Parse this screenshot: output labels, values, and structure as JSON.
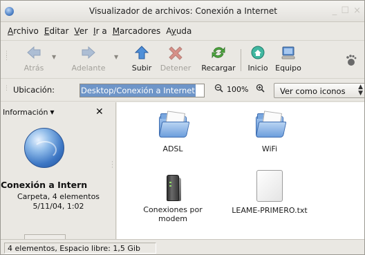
{
  "window": {
    "title": "Visualizador de archivos: Conexión a Internet",
    "controls": "_ ☐ ×"
  },
  "menubar": {
    "items": [
      {
        "ul": "A",
        "rest": "rchivo"
      },
      {
        "ul": "E",
        "rest": "ditar"
      },
      {
        "ul": "V",
        "rest": "er"
      },
      {
        "ul": "I",
        "rest": "r a"
      },
      {
        "ul": "M",
        "rest": "arcadores"
      },
      {
        "pre": "A",
        "ul": "y",
        "rest": "uda"
      }
    ]
  },
  "toolbar": {
    "back_label": "Atrás",
    "forward_label": "Adelante",
    "up_label": "Subir",
    "stop_label": "Detener",
    "reload_label": "Recargar",
    "home_label": "Inicio",
    "computer_label": "Equipo",
    "back_icon": "arrow-left-icon",
    "forward_icon": "arrow-right-icon",
    "up_icon": "arrow-up-icon",
    "stop_icon": "stop-icon",
    "reload_icon": "reload-icon",
    "home_icon": "home-icon",
    "computer_icon": "computer-icon"
  },
  "location": {
    "label": "Ubicación:",
    "value": "Desktop/Conexión a Internet",
    "zoom": "100%",
    "view_mode": "Ver como iconos"
  },
  "sidepane": {
    "header": "Información",
    "name": "Conexión a Intern",
    "kind": "Carpeta, 4 elementos",
    "date": "5/11/04, 1:02"
  },
  "items": [
    {
      "label": "ADSL",
      "icon": "folder-icon"
    },
    {
      "label": "WiFi",
      "icon": "folder-icon"
    },
    {
      "label": "Conexiones por",
      "label2": "modem",
      "icon": "modem-icon"
    },
    {
      "label": "LEAME-PRIMERO.txt",
      "icon": "text-file-icon"
    }
  ],
  "status": {
    "text": "4 elementos, Espacio libre: 1,5 Gib"
  },
  "colors": {
    "selection": "#6e95c8",
    "folder": "#5a8fd2",
    "window_bg": "#eae8e3"
  }
}
